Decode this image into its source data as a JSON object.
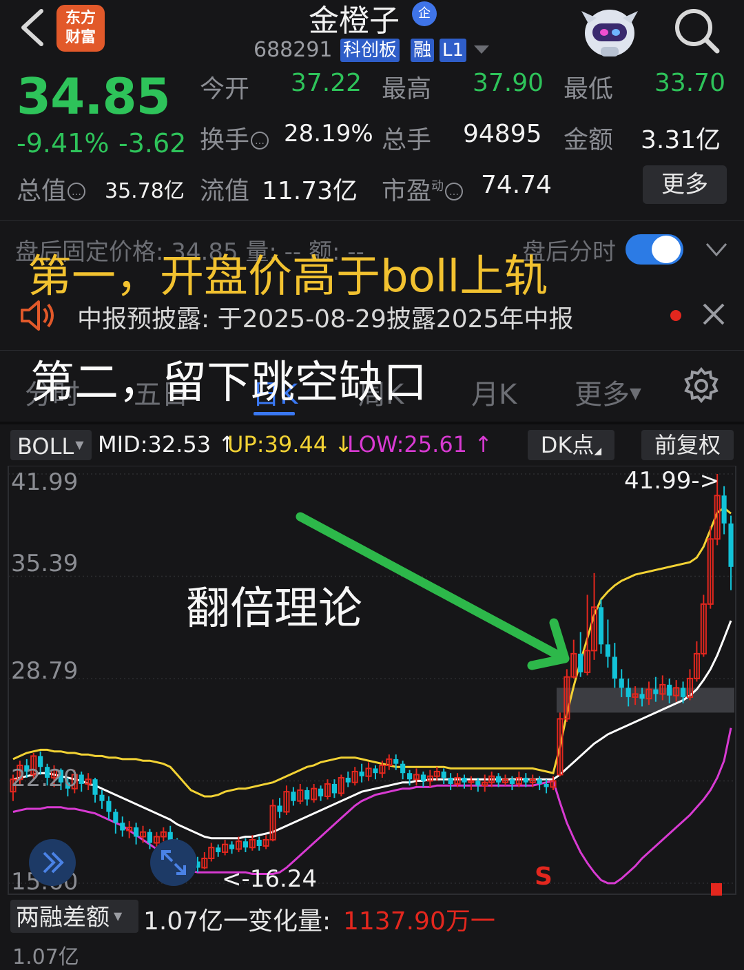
{
  "header": {
    "stock_name": "金橙子",
    "name_badge": "企",
    "stock_code": "688291",
    "tags": [
      "科创板",
      "融",
      "L1"
    ],
    "logo_text_line1": "东方",
    "logo_text_line2": "财富"
  },
  "quote": {
    "price": "34.85",
    "change_pct": "-9.41%",
    "change_amt": "-3.62",
    "open_label": "今开",
    "open": "37.22",
    "high_label": "最高",
    "high": "37.90",
    "low_label": "最低",
    "low": "33.70",
    "turnover_label": "换手",
    "turnover": "28.19%",
    "volume_label": "总手",
    "volume": "94895",
    "amount_label": "金额",
    "amount": "3.31亿",
    "mktcap_label": "总值",
    "mktcap": "35.78亿",
    "float_label": "流值",
    "float_cap": "11.73亿",
    "pe_label": "市盈",
    "pe_sup": "动",
    "pe": "74.74",
    "more_label": "更多"
  },
  "afterhours": {
    "text": "盘后固定价格: 34.85  量: --  额: --",
    "timeshare_label": "盘后分时",
    "toggle_on": true
  },
  "notice": {
    "text": "中报预披露: 于2025-08-29披露2025年中报"
  },
  "annotations": {
    "line1": "第一，开盘价高于boll上轨",
    "line2": "第二，留下跳空缺口",
    "chart_note": "翻倍理论"
  },
  "tabs": [
    {
      "label": "分时",
      "active": false
    },
    {
      "label": "五日",
      "active": false
    },
    {
      "label": "日K",
      "active": true
    },
    {
      "label": "周K",
      "active": false
    },
    {
      "label": "月K",
      "active": false
    },
    {
      "label": "更多",
      "active": false
    }
  ],
  "indicator": {
    "name": "BOLL",
    "mid": "MID:32.53",
    "up": "UP:39.44",
    "low": "LOW:25.61",
    "dk_label": "DK点",
    "adjust_label": "前复权"
  },
  "colors": {
    "up": "#e3271e",
    "down": "#12c3d8",
    "boll_up": "#f2d234",
    "boll_mid": "#ffffff",
    "boll_low": "#d83ad2",
    "arrow": "#2db84a"
  },
  "chart_data": {
    "type": "candlestick",
    "y_ticks": [
      "41.99",
      "35.39",
      "28.79",
      "22.20",
      "15.60"
    ],
    "ylim": [
      15.6,
      41.99
    ],
    "max_label": "41.99->",
    "min_label": "<-16.24",
    "signal_label": "S",
    "candles": [
      [
        21.5,
        22.3,
        20.9,
        22.6
      ],
      [
        22.3,
        23.2,
        21.9,
        23.5
      ],
      [
        23.2,
        22.8,
        22.4,
        23.6
      ],
      [
        22.6,
        23.8,
        22.3,
        24.0
      ],
      [
        23.8,
        23.1,
        22.6,
        24.1
      ],
      [
        23.1,
        22.4,
        21.9,
        23.3
      ],
      [
        22.4,
        22.9,
        21.8,
        23.2
      ],
      [
        22.9,
        22.1,
        21.6,
        23.0
      ],
      [
        22.1,
        21.7,
        21.2,
        22.4
      ],
      [
        21.7,
        22.6,
        21.4,
        22.9
      ],
      [
        22.6,
        22.0,
        21.5,
        22.8
      ],
      [
        22.0,
        22.3,
        21.6,
        22.7
      ],
      [
        22.3,
        21.3,
        20.8,
        22.4
      ],
      [
        21.3,
        20.9,
        20.4,
        21.6
      ],
      [
        20.9,
        20.2,
        19.7,
        21.2
      ],
      [
        20.2,
        19.5,
        18.8,
        20.4
      ],
      [
        19.5,
        19.0,
        18.6,
        19.9
      ],
      [
        19.0,
        19.2,
        18.5,
        19.6
      ],
      [
        19.2,
        18.6,
        18.1,
        19.5
      ],
      [
        18.6,
        18.9,
        18.2,
        19.3
      ],
      [
        18.9,
        18.2,
        17.8,
        19.1
      ],
      [
        18.2,
        18.6,
        17.9,
        18.9
      ],
      [
        18.6,
        18.9,
        18.3,
        19.2
      ],
      [
        18.9,
        18.4,
        18.0,
        19.3
      ],
      [
        18.4,
        16.8,
        16.24,
        18.5
      ],
      [
        16.8,
        17.5,
        16.6,
        17.8
      ],
      [
        17.5,
        17.0,
        16.4,
        17.7
      ],
      [
        17.0,
        16.6,
        16.3,
        17.3
      ],
      [
        16.6,
        17.2,
        16.5,
        17.6
      ],
      [
        17.2,
        17.9,
        17.0,
        18.2
      ],
      [
        17.9,
        17.6,
        17.3,
        18.1
      ],
      [
        17.6,
        18.1,
        17.4,
        18.4
      ],
      [
        18.1,
        17.8,
        17.5,
        18.3
      ],
      [
        17.8,
        18.3,
        17.6,
        18.6
      ],
      [
        18.3,
        17.9,
        17.6,
        18.5
      ],
      [
        17.9,
        18.4,
        17.7,
        18.7
      ],
      [
        18.4,
        18.0,
        17.7,
        18.6
      ],
      [
        18.0,
        18.4,
        17.8,
        18.7
      ],
      [
        18.4,
        20.6,
        18.3,
        21.0
      ],
      [
        20.6,
        20.2,
        19.8,
        21.1
      ],
      [
        20.2,
        21.5,
        20.0,
        21.9
      ],
      [
        21.5,
        20.9,
        20.6,
        21.8
      ],
      [
        20.9,
        21.6,
        20.7,
        22.0
      ],
      [
        21.6,
        21.0,
        20.6,
        21.8
      ],
      [
        21.0,
        21.7,
        20.8,
        22.0
      ],
      [
        21.7,
        21.2,
        20.9,
        21.9
      ],
      [
        21.2,
        22.0,
        21.0,
        22.3
      ],
      [
        22.0,
        21.4,
        21.1,
        22.3
      ],
      [
        21.4,
        22.4,
        21.2,
        22.6
      ],
      [
        22.4,
        22.1,
        21.8,
        22.8
      ],
      [
        22.1,
        22.8,
        21.9,
        23.1
      ],
      [
        22.8,
        22.5,
        22.1,
        23.3
      ],
      [
        22.5,
        23.0,
        22.2,
        23.4
      ],
      [
        23.0,
        22.7,
        22.3,
        23.2
      ],
      [
        22.7,
        23.2,
        22.4,
        23.5
      ],
      [
        23.2,
        23.6,
        22.9,
        23.9
      ],
      [
        23.6,
        23.3,
        22.9,
        23.9
      ],
      [
        23.3,
        22.7,
        22.3,
        23.5
      ],
      [
        22.7,
        22.3,
        21.9,
        22.9
      ],
      [
        22.3,
        22.6,
        21.9,
        23.0
      ],
      [
        22.6,
        22.2,
        21.8,
        22.8
      ],
      [
        22.2,
        22.5,
        21.8,
        22.9
      ],
      [
        22.5,
        22.8,
        22.2,
        23.1
      ],
      [
        22.8,
        22.4,
        22.0,
        23.0
      ],
      [
        22.4,
        22.0,
        21.6,
        22.7
      ],
      [
        22.0,
        22.4,
        21.8,
        22.7
      ],
      [
        22.4,
        22.1,
        21.7,
        22.6
      ],
      [
        22.1,
        22.2,
        21.6,
        22.5
      ],
      [
        22.2,
        21.9,
        21.5,
        22.4
      ],
      [
        21.9,
        22.1,
        21.5,
        22.6
      ],
      [
        22.1,
        22.5,
        21.8,
        22.8
      ],
      [
        22.5,
        22.1,
        21.8,
        22.7
      ],
      [
        22.1,
        22.3,
        21.9,
        22.6
      ],
      [
        22.3,
        22.0,
        21.6,
        22.5
      ],
      [
        22.0,
        22.4,
        21.8,
        22.8
      ],
      [
        22.4,
        22.1,
        21.8,
        22.7
      ],
      [
        22.1,
        22.3,
        21.8,
        22.6
      ],
      [
        22.3,
        22.0,
        21.6,
        22.5
      ],
      [
        22.0,
        21.8,
        21.4,
        22.3
      ],
      [
        21.8,
        22.2,
        21.6,
        22.5
      ],
      [
        22.6,
        26.2,
        22.5,
        26.6
      ],
      [
        26.2,
        28.9,
        26.0,
        29.4
      ],
      [
        28.9,
        30.4,
        28.8,
        31.3
      ],
      [
        30.4,
        29.2,
        28.9,
        31.8
      ],
      [
        29.2,
        30.6,
        29.0,
        34.2
      ],
      [
        30.6,
        33.4,
        30.0,
        35.6
      ],
      [
        33.4,
        31.0,
        30.4,
        33.9
      ],
      [
        31.0,
        30.2,
        29.5,
        32.6
      ],
      [
        30.2,
        28.8,
        28.2,
        31.1
      ],
      [
        28.8,
        28.2,
        27.6,
        29.4
      ],
      [
        28.2,
        27.6,
        27.0,
        28.8
      ],
      [
        27.6,
        27.8,
        27.1,
        28.3
      ],
      [
        27.8,
        27.5,
        27.0,
        28.2
      ],
      [
        27.5,
        28.1,
        27.1,
        28.6
      ],
      [
        28.1,
        27.8,
        27.3,
        28.9
      ],
      [
        27.8,
        28.4,
        27.4,
        29.0
      ],
      [
        28.4,
        27.7,
        27.2,
        28.8
      ],
      [
        27.7,
        28.2,
        27.3,
        28.7
      ],
      [
        28.2,
        27.6,
        27.2,
        28.6
      ],
      [
        27.6,
        28.8,
        27.4,
        29.4
      ],
      [
        28.8,
        30.4,
        28.6,
        31.2
      ],
      [
        30.4,
        33.6,
        30.2,
        34.2
      ],
      [
        33.6,
        37.8,
        33.3,
        38.6
      ],
      [
        37.8,
        40.6,
        37.4,
        41.99
      ],
      [
        40.6,
        38.8,
        38.1,
        41.2
      ],
      [
        38.8,
        36.0,
        34.5,
        39.3
      ]
    ],
    "boll_up": [
      23.6,
      23.8,
      24.0,
      24.1,
      24.2,
      24.2,
      24.1,
      24.1,
      24.0,
      24.0,
      23.9,
      23.9,
      23.8,
      23.8,
      23.7,
      23.7,
      23.6,
      23.6,
      23.6,
      23.5,
      23.5,
      23.4,
      23.3,
      23.1,
      22.6,
      22.1,
      21.6,
      21.4,
      21.2,
      21.2,
      21.3,
      21.5,
      21.6,
      21.7,
      21.7,
      21.8,
      21.9,
      22.0,
      22.1,
      22.3,
      22.5,
      22.7,
      22.9,
      23.1,
      23.2,
      23.4,
      23.5,
      23.6,
      23.7,
      23.7,
      23.7,
      23.6,
      23.5,
      23.4,
      23.3,
      23.2,
      23.1,
      23.1,
      23.1,
      23.1,
      23.1,
      23.1,
      23.1,
      23.1,
      23.0,
      23.0,
      23.0,
      23.0,
      23.0,
      23.0,
      23.0,
      23.0,
      23.0,
      23.0,
      23.0,
      23.0,
      23.0,
      22.9,
      22.8,
      22.7,
      24.4,
      26.5,
      28.3,
      29.9,
      31.4,
      32.9,
      33.9,
      34.4,
      34.8,
      35.1,
      35.3,
      35.5,
      35.6,
      35.7,
      35.8,
      35.9,
      36.0,
      36.1,
      36.2,
      36.3,
      36.6,
      37.3,
      38.4,
      39.5,
      39.8,
      39.44
    ],
    "boll_mid": [
      22.3,
      22.4,
      22.5,
      22.6,
      22.7,
      22.7,
      22.6,
      22.5,
      22.4,
      22.3,
      22.2,
      22.0,
      21.9,
      21.7,
      21.5,
      21.3,
      21.1,
      20.9,
      20.7,
      20.5,
      20.3,
      20.1,
      19.9,
      19.7,
      19.4,
      19.2,
      19.0,
      18.8,
      18.6,
      18.5,
      18.5,
      18.5,
      18.5,
      18.5,
      18.6,
      18.6,
      18.7,
      18.8,
      18.9,
      19.1,
      19.3,
      19.5,
      19.7,
      19.9,
      20.1,
      20.3,
      20.5,
      20.7,
      20.9,
      21.1,
      21.3,
      21.5,
      21.6,
      21.7,
      21.8,
      21.9,
      22.0,
      22.1,
      22.1,
      22.2,
      22.2,
      22.3,
      22.3,
      22.3,
      22.3,
      22.3,
      22.3,
      22.3,
      22.3,
      22.3,
      22.3,
      22.3,
      22.3,
      22.3,
      22.3,
      22.3,
      22.3,
      22.3,
      22.3,
      22.3,
      22.6,
      23.0,
      23.4,
      23.8,
      24.2,
      24.6,
      24.9,
      25.2,
      25.4,
      25.6,
      25.8,
      26.0,
      26.2,
      26.4,
      26.6,
      26.8,
      27.0,
      27.2,
      27.4,
      27.7,
      28.1,
      28.7,
      29.4,
      30.3,
      31.4,
      32.53
    ],
    "boll_low": [
      20.2,
      20.3,
      20.4,
      20.4,
      20.4,
      20.5,
      20.5,
      20.5,
      20.4,
      20.4,
      20.3,
      20.2,
      20.1,
      19.9,
      19.7,
      19.5,
      19.3,
      19.0,
      18.7,
      18.4,
      18.1,
      17.8,
      17.5,
      17.2,
      16.9,
      16.6,
      16.4,
      16.3,
      16.3,
      16.3,
      16.3,
      16.3,
      16.3,
      16.3,
      16.3,
      16.2,
      16.2,
      16.2,
      16.2,
      16.3,
      16.6,
      17.0,
      17.4,
      17.8,
      18.2,
      18.6,
      19.0,
      19.4,
      19.8,
      20.2,
      20.6,
      20.9,
      21.1,
      21.3,
      21.4,
      21.5,
      21.6,
      21.7,
      21.7,
      21.8,
      21.8,
      21.8,
      21.9,
      21.9,
      21.9,
      21.9,
      21.9,
      21.9,
      21.9,
      21.9,
      21.9,
      21.9,
      21.9,
      21.9,
      21.9,
      21.9,
      21.9,
      22.0,
      22.1,
      22.2,
      20.8,
      19.5,
      18.5,
      17.6,
      16.9,
      16.3,
      15.8,
      15.6,
      15.6,
      15.9,
      16.3,
      16.7,
      17.2,
      17.6,
      18.0,
      18.4,
      18.8,
      19.2,
      19.6,
      20.0,
      20.5,
      21.0,
      21.6,
      22.4,
      23.5,
      25.61
    ],
    "gap_band": [
      26.6,
      28.2
    ]
  },
  "margin": {
    "select_label": "两融差额",
    "value": "1.07亿一",
    "change_label": "变化量:",
    "change_value": "1137.90万一",
    "cut_text": "1.07亿"
  }
}
